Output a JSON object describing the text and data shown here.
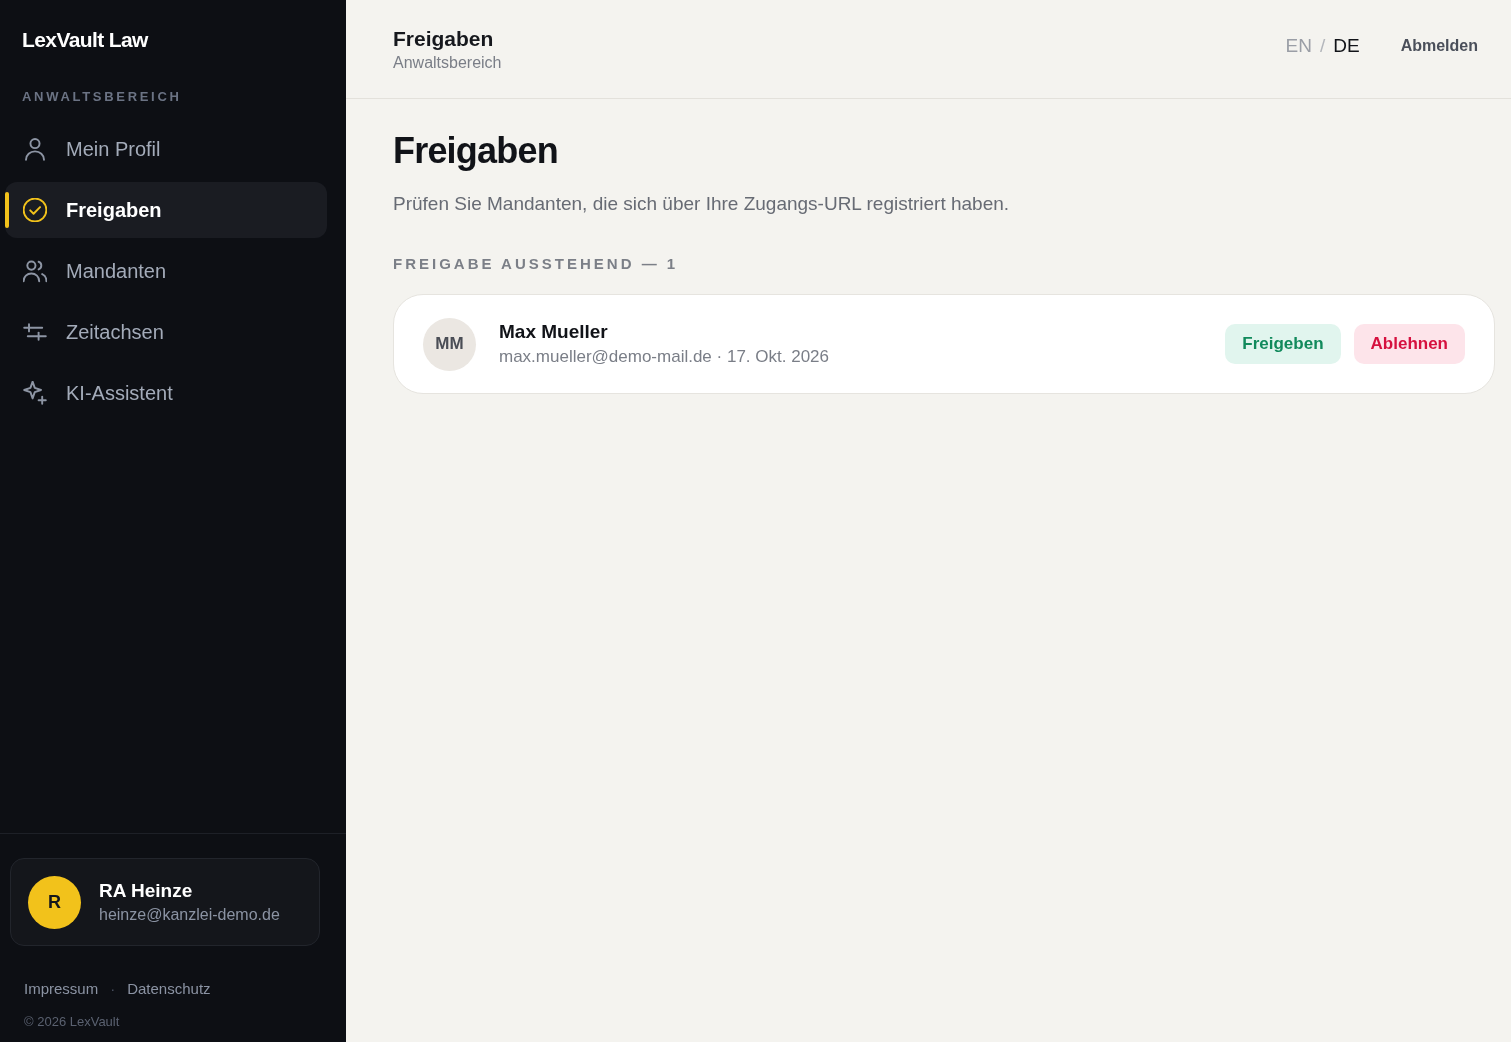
{
  "sidebar": {
    "brand": "LexVault Law",
    "section_label": "ANWALTSBEREICH",
    "items": [
      {
        "label": "Mein Profil",
        "selected": false
      },
      {
        "label": "Freigaben",
        "selected": true
      },
      {
        "label": "Mandanten",
        "selected": false
      },
      {
        "label": "Zeitachsen",
        "selected": false
      },
      {
        "label": "KI-Assistent",
        "selected": false
      }
    ],
    "user": {
      "initial": "R",
      "name": "RA Heinze",
      "email": "heinze@kanzlei-demo.de"
    },
    "footer_links": [
      "Impressum",
      "Datenschutz"
    ],
    "footer_separator": "·",
    "copyright": "© 2026 LexVault"
  },
  "header": {
    "title": "Freigaben",
    "subtitle": "Anwaltsbereich",
    "languages": [
      {
        "label": "EN",
        "selected": false
      },
      {
        "label": "DE",
        "selected": true
      }
    ],
    "language_separator": "/",
    "logout": "Abmelden"
  },
  "page": {
    "title": "Freigaben",
    "description": "Prüfen Sie Mandanten, die sich über Ihre Zugangs-URL registriert haben.",
    "section_label": "FREIGABE AUSSTEHEND — 1",
    "requests": [
      {
        "initials": "MM",
        "name": "Max Mueller",
        "meta": "max.mueller@demo-mail.de · 17. Okt. 2026",
        "actions": [
          {
            "kind": "approve",
            "label": "Freigeben"
          },
          {
            "kind": "reject",
            "label": "Ablehnen"
          }
        ]
      }
    ]
  }
}
